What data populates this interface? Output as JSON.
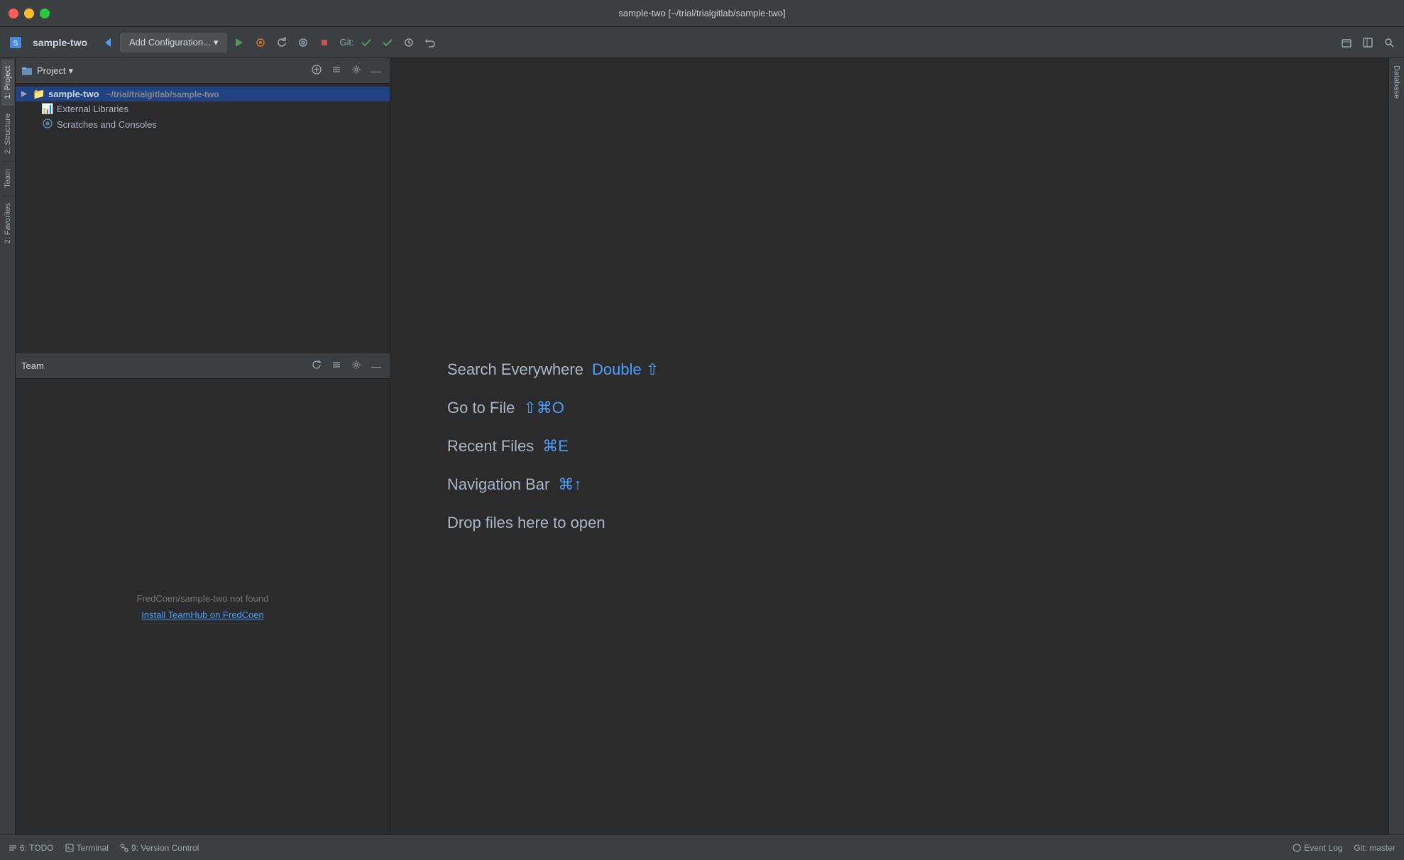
{
  "titleBar": {
    "title": "sample-two [~/trial/trialgitlab/sample-two]"
  },
  "toolbar": {
    "appName": "sample-two",
    "addConfigLabel": "Add Configuration...",
    "gitLabel": "Git:",
    "icons": {
      "back": "◀",
      "run": "▶",
      "debug": "🐛",
      "rerun": "↻",
      "coverage": "◎",
      "stop": "■",
      "check1": "✓",
      "check2": "✓",
      "history": "⏱",
      "undo": "↩",
      "project": "📁",
      "layout": "⊟",
      "search": "🔍"
    }
  },
  "projectPanel": {
    "title": "Project",
    "rootItem": {
      "name": "sample-two",
      "path": "~/trial/trialgitlab/sample-two"
    },
    "children": [
      {
        "name": "External Libraries",
        "icon": "library"
      },
      {
        "name": "Scratches and Consoles",
        "icon": "scratches"
      }
    ]
  },
  "teamPanel": {
    "title": "Team",
    "notFoundText": "FredCoen/sample-two not found",
    "installLink": "Install TeamHub on FredCoen"
  },
  "editorArea": {
    "shortcuts": [
      {
        "label": "Search Everywhere",
        "key": "Double ⇧"
      },
      {
        "label": "Go to File",
        "key": "⇧⌘O"
      },
      {
        "label": "Recent Files",
        "key": "⌘E"
      },
      {
        "label": "Navigation Bar",
        "key": "⌘↑"
      }
    ],
    "dropText": "Drop files here to open"
  },
  "rightSidebar": {
    "tabs": [
      "Database"
    ]
  },
  "leftTabs": [
    {
      "id": "project",
      "label": "1: Project"
    },
    {
      "id": "structure",
      "label": "2: Structure"
    },
    {
      "id": "team",
      "label": "Team"
    },
    {
      "id": "favorites",
      "label": "2: Favorites"
    }
  ],
  "statusBar": {
    "todo": "6: TODO",
    "terminal": "Terminal",
    "versionControl": "9: Version Control",
    "eventLog": "Event Log",
    "git": "Git: master"
  }
}
